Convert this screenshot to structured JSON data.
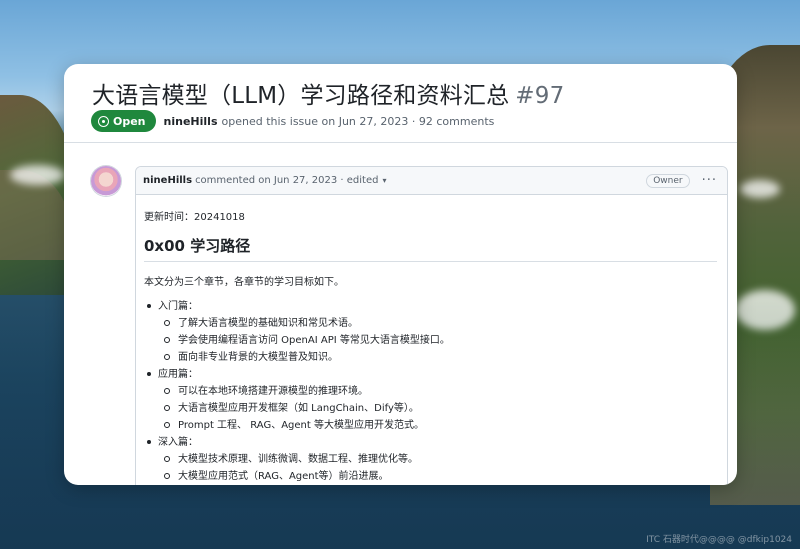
{
  "issue": {
    "title": "大语言模型（LLM）学习路径和资料汇总",
    "number": "#97",
    "status": "Open",
    "author": "nineHills",
    "meta": "opened this issue on Jun 27, 2023 · 92 comments"
  },
  "comment": {
    "author": "nineHills",
    "meta": "commented on Jun 27, 2023 · edited",
    "role_badge": "Owner",
    "menu": "···",
    "updated": "更新时间：20241018",
    "heading": "0x00 学习路径",
    "intro": "本文分为三个章节，各章节的学习目标如下。",
    "sections": [
      {
        "title": "入门篇：",
        "items": [
          "了解大语言模型的基础知识和常见术语。",
          "学会使用编程语言访问 OpenAI API 等常见大语言模型接口。",
          "面向非专业背景的大模型普及知识。"
        ]
      },
      {
        "title": "应用篇：",
        "items": [
          "可以在本地环境搭建开源模型的推理环境。",
          "大语言模型应用开发框架（如 LangChain、Dify等）。",
          "Prompt 工程、 RAG、Agent 等大模型应用开发范式。"
        ]
      },
      {
        "title": "深入篇：",
        "items": [
          "大模型技术原理、训练微调、数据工程、推理优化等。",
          "大模型应用范式（RAG、Agent等）前沿进展。"
        ]
      }
    ]
  },
  "watermark": "ITC 石器时代@@@@ @dfkip1024",
  "colors": {
    "open_badge": "#1f883d",
    "title_number": "#636c76",
    "border": "#d0d7de"
  }
}
